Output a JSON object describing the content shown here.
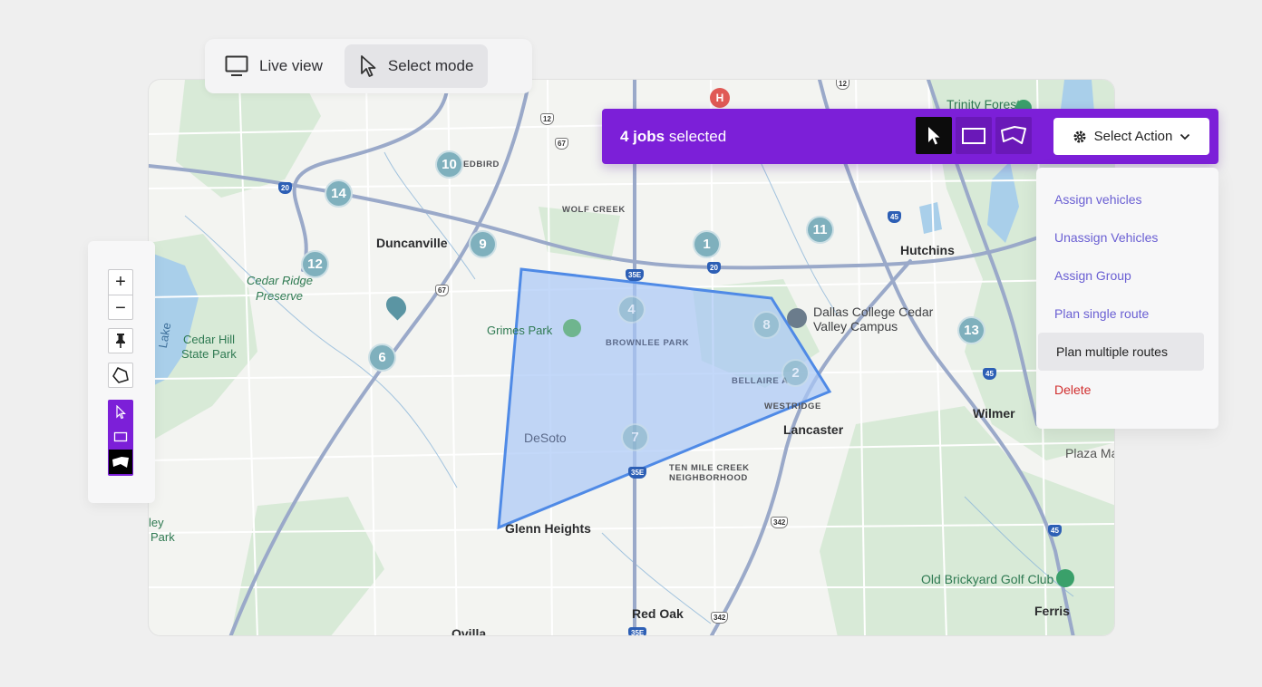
{
  "mode_toggle": {
    "live_view_label": "Live view",
    "select_mode_label": "Select mode",
    "active": "Select mode"
  },
  "selection_bar": {
    "count_bold": "4 jobs",
    "count_rest": " selected",
    "tools": [
      "pointer-icon",
      "rectangle-icon",
      "lasso-icon"
    ],
    "active_tool": "pointer-icon",
    "action_label": "Select Action"
  },
  "action_menu": {
    "items": [
      {
        "label": "Assign vehicles"
      },
      {
        "label": "Unassign Vehicles"
      },
      {
        "label": "Assign Group"
      },
      {
        "label": "Plan single route"
      },
      {
        "label": "Plan multiple routes",
        "highlighted": true
      },
      {
        "label": "Delete",
        "danger": true
      }
    ]
  },
  "side_tools": {
    "zoom_in": "+",
    "zoom_out": "−",
    "icons": [
      "pin-icon",
      "polygon-icon",
      "pointer-icon",
      "rectangle-icon",
      "lasso-icon"
    ],
    "active_draw_tool": "lasso-icon"
  },
  "map": {
    "cities": {
      "duncanville": "Duncanville",
      "hutchins": "Hutchins",
      "lancaster": "Lancaster",
      "wilmer": "Wilmer",
      "glenn_heights": "Glenn Heights",
      "red_oak": "Red Oak",
      "ferris": "Ferris",
      "ovilla": "Ovilla",
      "desoto": "DeSoto",
      "plaza": "Plaza Ma"
    },
    "neighborhoods": {
      "wolf_creek": "WOLF CREEK",
      "brownlee": "BROWNLEE PARK",
      "bellaire": "BELLAIRE A",
      "westridge": "WESTRIDGE",
      "ten_mile_1": "TEN MILE CREEK",
      "ten_mile_2": "NEIGHBORHOOD",
      "redbird": "EDBIRD"
    },
    "parks": {
      "cedar_ridge_1": "Cedar Ridge",
      "cedar_ridge_2": "Preserve",
      "cedar_hill_1": "Cedar Hill",
      "cedar_hill_2": "State Park",
      "grimes": "Grimes Park",
      "lake": "Lake",
      "ley": "ley",
      "park": "Park"
    },
    "pois": {
      "dallas_college_1": "Dallas College Cedar",
      "dallas_college_2": "Valley Campus",
      "trinity": "Trinity Forest",
      "golf": "Old Brickyard Golf Club"
    },
    "route_shields": [
      "12",
      "67",
      "20",
      "35E",
      "45",
      "342",
      "12",
      "342",
      "20",
      "67",
      "35E",
      "35E",
      "45",
      "45"
    ],
    "markers": [
      {
        "num": "10",
        "dim": false
      },
      {
        "num": "14",
        "dim": false
      },
      {
        "num": "9",
        "dim": false
      },
      {
        "num": "12",
        "dim": false
      },
      {
        "num": "6",
        "dim": false
      },
      {
        "num": "1",
        "dim": false
      },
      {
        "num": "11",
        "dim": false
      },
      {
        "num": "13",
        "dim": false
      },
      {
        "num": "4",
        "dim": true
      },
      {
        "num": "8",
        "dim": true
      },
      {
        "num": "2",
        "dim": true
      },
      {
        "num": "7",
        "dim": true
      }
    ]
  },
  "colors": {
    "accent": "#7c1fd8",
    "marker": "#7fb0bd",
    "selection_fill": "#a9c7f7",
    "selection_stroke": "#4f8ae6",
    "danger": "#d12e2e",
    "menu_text": "#6a5fd3"
  }
}
